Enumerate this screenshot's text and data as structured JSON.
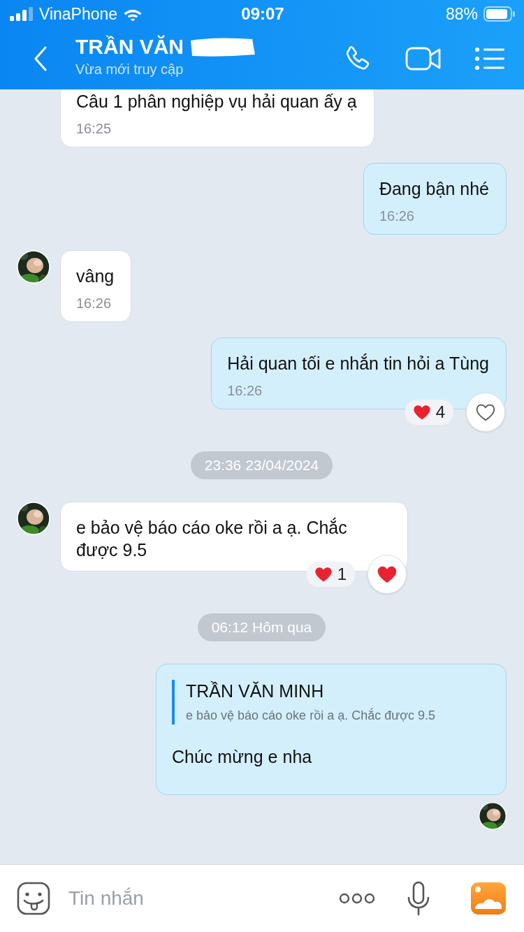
{
  "status_bar": {
    "carrier": "VinaPhone",
    "time": "09:07",
    "battery": "88%"
  },
  "header": {
    "title": "TRẦN VĂN",
    "name_redacted": true,
    "subtitle": "Vừa mới truy cập"
  },
  "messages": [
    {
      "kind": "incoming",
      "text": "Câu 1 phân nghiệp vụ hải quan ấy ạ",
      "time": "16:25",
      "avatar": false
    },
    {
      "kind": "outgoing",
      "text": "Đang bận nhé",
      "time": "16:26"
    },
    {
      "kind": "incoming",
      "text": "vâng",
      "time": "16:26",
      "avatar": true
    },
    {
      "kind": "outgoing",
      "text": "Hải quan tối e nhắn tin hỏi a Tùng",
      "time": "16:26",
      "reaction": {
        "count": "4",
        "liked": false
      }
    },
    {
      "kind": "date",
      "text": "23:36 23/04/2024"
    },
    {
      "kind": "incoming",
      "text": "e bảo vệ báo cáo oke rồi a ạ. Chắc được 9.5",
      "avatar": true,
      "reaction": {
        "count": "1",
        "liked": true
      }
    },
    {
      "kind": "date",
      "text": "06:12 Hôm qua"
    },
    {
      "kind": "reply",
      "quote_name": "TRẦN VĂN MINH",
      "quote_text": "e bảo vệ báo cáo oke rồi a ạ. Chắc được 9.5",
      "text": "Chúc mừng e nha"
    },
    {
      "kind": "seen"
    }
  ],
  "composer": {
    "placeholder": "Tin nhắn"
  }
}
